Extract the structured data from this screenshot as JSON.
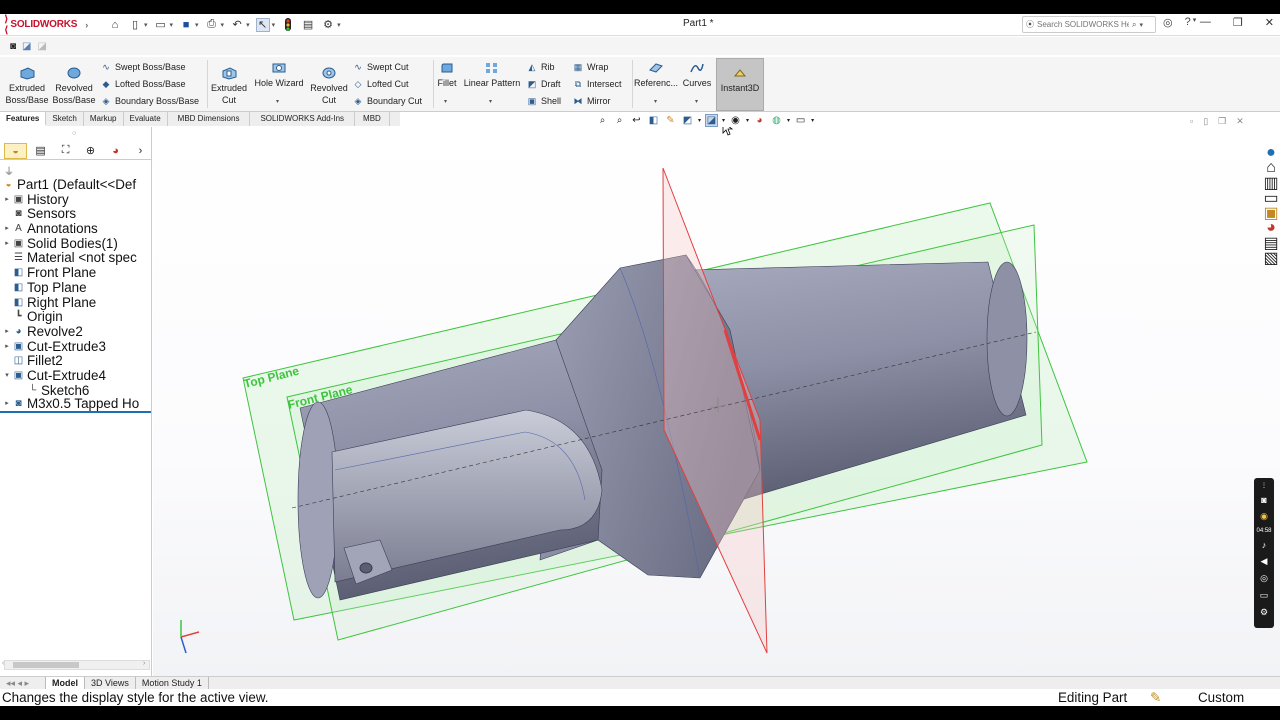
{
  "app": {
    "brand": "SOLIDWORKS",
    "document_title": "Part1 *"
  },
  "search": {
    "placeholder": "Search SOLIDWORKS Help"
  },
  "ribbon": {
    "extruded_boss": "Extruded Boss/Base",
    "revolved_boss": "Revolved Boss/Base",
    "swept_boss": "Swept Boss/Base",
    "lofted_boss": "Lofted Boss/Base",
    "boundary_boss": "Boundary Boss/Base",
    "extruded_cut": "Extruded Cut",
    "hole_wizard": "Hole Wizard",
    "revolved_cut": "Revolved Cut",
    "swept_cut": "Swept Cut",
    "lofted_cut": "Lofted Cut",
    "boundary_cut": "Boundary Cut",
    "fillet": "Fillet",
    "linear_pattern": "Linear Pattern",
    "rib": "Rib",
    "draft": "Draft",
    "shell": "Shell",
    "wrap": "Wrap",
    "intersect": "Intersect",
    "mirror": "Mirror",
    "reference": "Referenc...",
    "curves": "Curves",
    "instant3d": "Instant3D"
  },
  "tabs": [
    "Features",
    "Sketch",
    "Markup",
    "Evaluate",
    "MBD Dimensions",
    "SOLIDWORKS Add-Ins",
    "MBD"
  ],
  "tree": [
    {
      "label": "Part1  (Default<<Def",
      "icon": "part-icon",
      "expand": false,
      "indent": 0
    },
    {
      "label": "History",
      "icon": "history-icon",
      "expand": true,
      "indent": 1
    },
    {
      "label": "Sensors",
      "icon": "sensor-icon",
      "expand": false,
      "indent": 1
    },
    {
      "label": "Annotations",
      "icon": "annotation-icon",
      "expand": true,
      "indent": 1
    },
    {
      "label": "Solid Bodies(1)",
      "icon": "solid-bodies-icon",
      "expand": true,
      "indent": 1
    },
    {
      "label": "Material <not spec",
      "icon": "material-icon",
      "expand": false,
      "indent": 1
    },
    {
      "label": "Front Plane",
      "icon": "plane-icon",
      "expand": false,
      "indent": 1
    },
    {
      "label": "Top Plane",
      "icon": "plane-icon",
      "expand": false,
      "indent": 1
    },
    {
      "label": "Right Plane",
      "icon": "plane-icon",
      "expand": false,
      "indent": 1
    },
    {
      "label": "Origin",
      "icon": "origin-icon",
      "expand": false,
      "indent": 1
    },
    {
      "label": "Revolve2",
      "icon": "revolve-icon",
      "expand": true,
      "indent": 1
    },
    {
      "label": "Cut-Extrude3",
      "icon": "cut-extrude-icon",
      "expand": true,
      "indent": 1
    },
    {
      "label": "Fillet2",
      "icon": "fillet-icon",
      "expand": false,
      "indent": 1
    },
    {
      "label": "Cut-Extrude4",
      "icon": "cut-extrude-icon",
      "expand": "open",
      "indent": 1
    },
    {
      "label": "Sketch6",
      "icon": "sketch-icon",
      "expand": false,
      "indent": 2
    },
    {
      "label": "M3x0.5 Tapped Ho",
      "icon": "hole-icon",
      "expand": true,
      "indent": 1
    }
  ],
  "viewport": {
    "top_plane_label": "Top Plane",
    "front_plane_label": "Front Plane"
  },
  "bottom_tabs": [
    "Model",
    "3D Views",
    "Motion Study 1"
  ],
  "status": {
    "message": "Changes the display style for the active view.",
    "mode": "Editing Part",
    "units": "Custom"
  },
  "recorder": {
    "time": "04:58"
  },
  "colors": {
    "brand": "#c8102e",
    "plane_green": "#3ec43e",
    "plane_red": "#e04040",
    "model_body": "#8e91a6",
    "accent": "#1f6fb3"
  }
}
